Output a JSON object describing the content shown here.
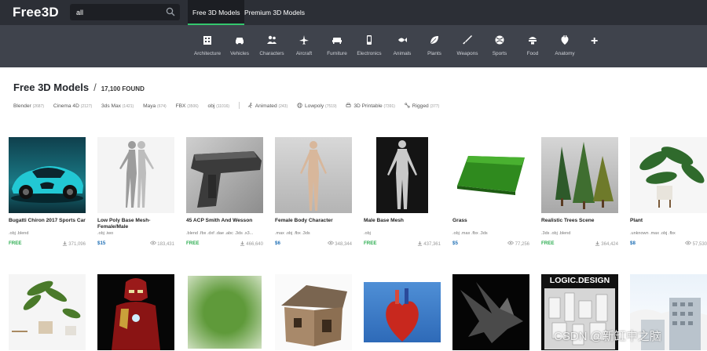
{
  "header": {
    "logo": "Free3D",
    "search_value": "all",
    "tabs": [
      "Free 3D Models",
      "Premium 3D Models"
    ]
  },
  "categories": [
    "Architecture",
    "Vehicles",
    "Characters",
    "Aircraft",
    "Furniture",
    "Electronics",
    "Animals",
    "Plants",
    "Weapons",
    "Sports",
    "Food",
    "Anatomy"
  ],
  "page": {
    "title": "Free 3D Models",
    "separator": "/",
    "count": "17,100 FOUND"
  },
  "filters": {
    "formats": [
      {
        "label": "Blender",
        "count": "(2687)"
      },
      {
        "label": "Cinema 4D",
        "count": "(2127)"
      },
      {
        "label": "3ds Max",
        "count": "(1421)"
      },
      {
        "label": "Maya",
        "count": "(674)"
      },
      {
        "label": "FBX",
        "count": "(3506)"
      },
      {
        "label": "obj",
        "count": "(11016)"
      }
    ],
    "tags": [
      {
        "label": "Animated",
        "count": "(243)"
      },
      {
        "label": "Lowpoly",
        "count": "(7519)"
      },
      {
        "label": "3D Printable",
        "count": "(7391)"
      },
      {
        "label": "Rigged",
        "count": "(377)"
      }
    ]
  },
  "models": [
    {
      "title": "Bugatti Chiron 2017 Sports Car",
      "formats": ".obj .blend",
      "price": "FREE",
      "stat": "371,096"
    },
    {
      "title": "Low Poly Base Mesh-Female/Male",
      "formats": ".obj .iwo",
      "price": "$15",
      "stat": "183,431"
    },
    {
      "title": "45 ACP Smith And Wesson",
      "formats": ".blend .fbx .dxf .dae .abc .3ds .x3...",
      "price": "FREE",
      "stat": "466,640"
    },
    {
      "title": "Female Body Character",
      "formats": ".max .obj .fbx .3ds",
      "price": "$6",
      "stat": "348,344"
    },
    {
      "title": "Male Base Mesh",
      "formats": ".obj",
      "price": "FREE",
      "stat": "437,361"
    },
    {
      "title": "Grass",
      "formats": ".obj .max .fbx .3ds",
      "price": "$5",
      "stat": "77,256"
    },
    {
      "title": "Realistic Trees Scene",
      "formats": ".3ds .obj .blend",
      "price": "FREE",
      "stat": "364,424"
    },
    {
      "title": "Plant",
      "formats": ".unknown .max .obj .fbx",
      "price": "$8",
      "stat": "57,530"
    }
  ],
  "row2_text": {
    "logic_design": "LOGIC.DESIGN"
  },
  "watermark": "CSDN @新缸中之脑",
  "colors": {
    "topbar": "#2c2f36",
    "catbar": "#3f434c",
    "accent": "#34c76e",
    "free": "#2fae52",
    "paid": "#1f6fb5"
  }
}
